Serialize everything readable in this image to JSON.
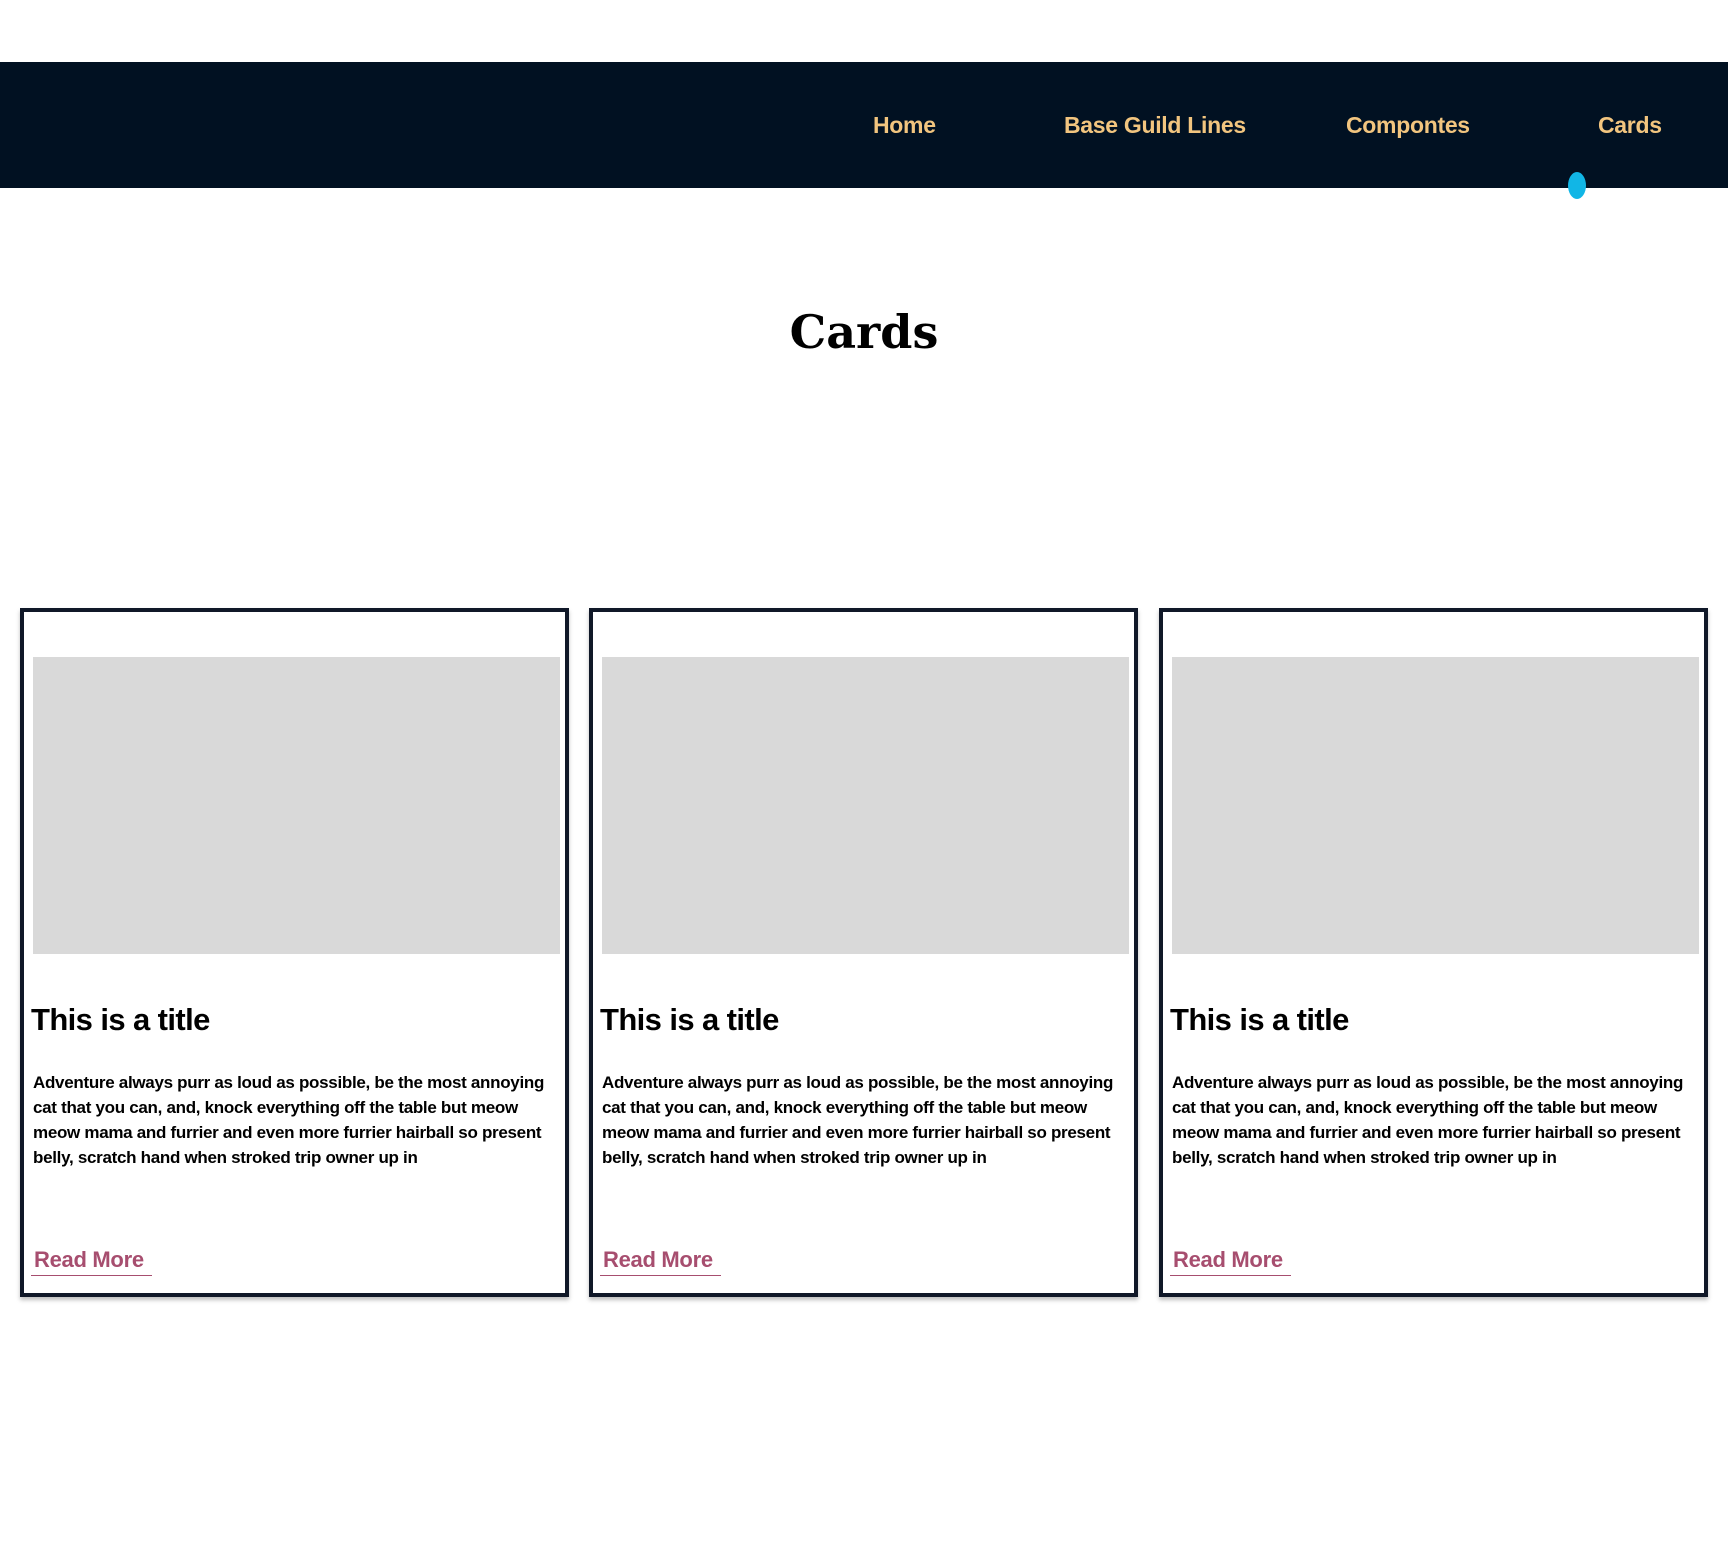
{
  "colors": {
    "nav_background": "#011122",
    "nav_text": "#F2C57F",
    "active_indicator": "#11B6E6",
    "link": "#A74E6F",
    "card_border": "#101828",
    "image_placeholder": "#D9D9D9"
  },
  "nav": {
    "items": [
      {
        "label": "Home",
        "active": false
      },
      {
        "label": "Base Guild Lines",
        "active": false
      },
      {
        "label": "Compontes",
        "active": false
      },
      {
        "label": "Cards",
        "active": true
      }
    ]
  },
  "main": {
    "title": "Cards",
    "cards": [
      {
        "title": "This is a title",
        "body": "Adventure always purr as loud as possible, be the most annoying cat that you can, and, knock everything off the table but meow meow mama and furrier and even more furrier hairball so present belly, scratch hand when stroked trip owner up in",
        "link": "Read More"
      },
      {
        "title": "This is a title",
        "body": "Adventure always purr as loud as possible, be the most annoying cat that you can, and, knock everything off the table but meow meow mama and furrier and even more furrier hairball so present belly, scratch hand when stroked trip owner up in",
        "link": "Read More"
      },
      {
        "title": "This is a title",
        "body": "Adventure always purr as loud as possible, be the most annoying cat that you can, and, knock everything off the table but meow meow mama and furrier and even more furrier hairball so present belly, scratch hand when stroked trip owner up in",
        "link": "Read More"
      }
    ]
  }
}
